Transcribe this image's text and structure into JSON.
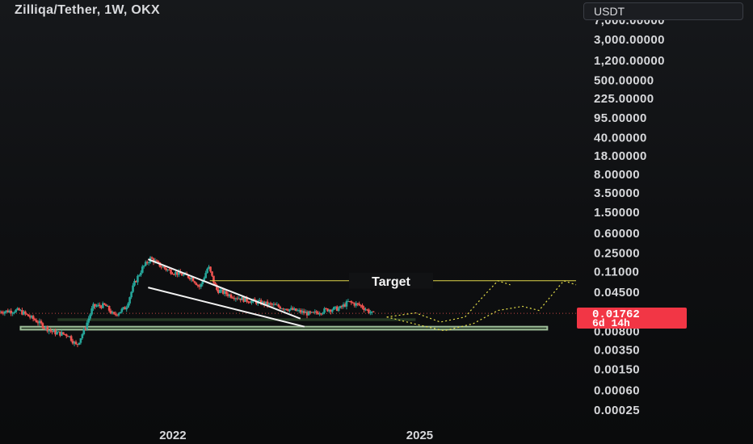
{
  "header": {
    "title": "Zilliqa/Tether, 1W, OKX",
    "currency": "USDT"
  },
  "price_badge": {
    "value": "0.01762",
    "countdown": "6d 14h"
  },
  "colors": {
    "up": "#26a69a",
    "down": "#ef5350",
    "badge": "#f23645",
    "target": "#e0d54a",
    "projection": "#e7e04a",
    "zone": "#7fae7a",
    "axis_text": "#d7d8db"
  },
  "chart_data": {
    "type": "candlestick",
    "scale": "log",
    "xlabel": "",
    "ylabel": "",
    "x_ticks": [
      "2022",
      "2025"
    ],
    "y_ticks": [
      7000,
      3000,
      1200,
      500,
      225,
      95,
      40,
      18,
      8,
      3.5,
      1.5,
      0.6,
      0.25,
      0.11,
      0.045,
      0.0176,
      0.008,
      0.0035,
      0.0015,
      0.0006,
      0.00025
    ],
    "y_tick_labels": [
      "7,000.00000",
      "3,000.00000",
      "1,200.00000",
      "500.00000",
      "225.00000",
      "95.00000",
      "40.00000",
      "18.00000",
      "8.00000",
      "3.50000",
      "1.50000",
      "0.60000",
      "0.25000",
      "0.11000",
      "0.04500",
      "0.01762",
      "0.00800",
      "0.00350",
      "0.00150",
      "0.00060",
      "0.00025"
    ],
    "current_price": 0.01762,
    "annotations": [
      {
        "text": "Target",
        "price": 0.074
      }
    ],
    "price_path": [
      [
        2019.9,
        0.019
      ],
      [
        2020.15,
        0.02
      ],
      [
        2020.35,
        0.013
      ],
      [
        2020.55,
        0.0078
      ],
      [
        2020.75,
        0.0068
      ],
      [
        2020.85,
        0.0042
      ],
      [
        2020.95,
        0.009
      ],
      [
        2021.05,
        0.024
      ],
      [
        2021.2,
        0.025
      ],
      [
        2021.3,
        0.016
      ],
      [
        2021.45,
        0.023
      ],
      [
        2021.55,
        0.065
      ],
      [
        2021.65,
        0.13
      ],
      [
        2021.75,
        0.2
      ],
      [
        2021.85,
        0.15
      ],
      [
        2021.95,
        0.12
      ],
      [
        2022.1,
        0.1
      ],
      [
        2022.25,
        0.085
      ],
      [
        2022.35,
        0.055
      ],
      [
        2022.45,
        0.14
      ],
      [
        2022.55,
        0.05
      ],
      [
        2022.7,
        0.04
      ],
      [
        2022.9,
        0.032
      ],
      [
        2023.1,
        0.028
      ],
      [
        2023.3,
        0.024
      ],
      [
        2023.5,
        0.02
      ],
      [
        2023.7,
        0.017
      ],
      [
        2023.9,
        0.021
      ],
      [
        2024.05,
        0.022
      ],
      [
        2024.15,
        0.029
      ],
      [
        2024.3,
        0.025
      ],
      [
        2024.45,
        0.017
      ]
    ],
    "falling_wedge": {
      "upper": [
        [
          2021.7,
          0.19
        ],
        [
          2023.55,
          0.014
        ]
      ],
      "lower": [
        [
          2021.7,
          0.055
        ],
        [
          2023.6,
          0.0098
        ]
      ]
    },
    "zones": [
      {
        "from": 2020.6,
        "to": 2024.95,
        "low": 0.0126,
        "high": 0.0142
      },
      {
        "from": 2020.15,
        "to": 2026.55,
        "low": 0.0086,
        "high": 0.0098
      }
    ],
    "target_line": {
      "from": 2022.45,
      "to": 2026.9,
      "price": 0.074
    },
    "projections": [
      [
        [
          2024.6,
          0.015
        ],
        [
          2024.95,
          0.018
        ],
        [
          2025.25,
          0.012
        ],
        [
          2025.55,
          0.015
        ],
        [
          2025.75,
          0.034
        ],
        [
          2025.95,
          0.074
        ],
        [
          2026.1,
          0.062
        ]
      ],
      [
        [
          2024.6,
          0.015
        ],
        [
          2025.0,
          0.0105
        ],
        [
          2025.3,
          0.0082
        ],
        [
          2025.65,
          0.0112
        ],
        [
          2025.95,
          0.02
        ],
        [
          2026.25,
          0.024
        ],
        [
          2026.45,
          0.02
        ],
        [
          2026.75,
          0.074
        ],
        [
          2026.9,
          0.062
        ]
      ]
    ]
  }
}
